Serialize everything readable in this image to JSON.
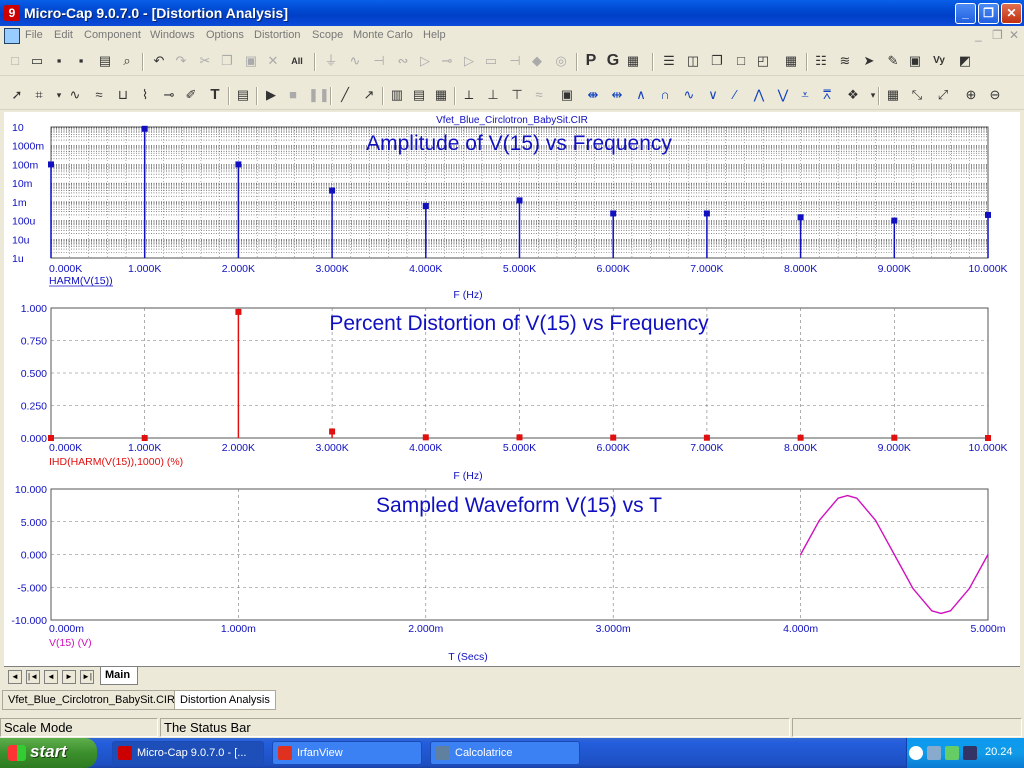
{
  "window": {
    "title": "Micro-Cap 9.0.7.0 - [Distortion Analysis]",
    "minimize": "_",
    "restore": "❐",
    "close": "✕"
  },
  "menu": {
    "items": [
      "File",
      "Edit",
      "Component",
      "Windows",
      "Options",
      "Distortion",
      "Scope",
      "Monte Carlo",
      "Help"
    ],
    "mdi_minimize": "_",
    "mdi_restore": "❐",
    "mdi_close": "✕"
  },
  "toolbar1": {
    "p_label": "P",
    "g_label": "G",
    "icons": [
      "new-icon",
      "open-icon",
      "save-icon",
      "save-all-icon",
      "print-icon",
      "print-preview-icon",
      "undo-icon",
      "redo-icon",
      "cut-icon",
      "copy-icon",
      "paste-icon",
      "delete-icon",
      "select-all-icon",
      "ground-icon",
      "resistor-icon",
      "capacitor-icon",
      "inductor-icon",
      "diode-icon",
      "transistor-icon",
      "opamp-icon",
      "macro-icon",
      "battery-icon",
      "node-icon",
      "source-icon",
      "probe-icon",
      "tile-horizontal-icon",
      "tile-vertical-icon",
      "cascade-icon",
      "maximize-icon",
      "restore-icon",
      "calculator-icon",
      "component-list-icon",
      "waveform-icon",
      "pen-icon",
      "eyedropper-icon",
      "picture-icon",
      "vy-icon",
      "window-icon"
    ]
  },
  "toolbar2": {
    "text_tool": "T",
    "icons": [
      "select-arrow-icon",
      "select-mode-icon",
      "wire-icon",
      "bezier-icon",
      "flag-icon",
      "grid-icon",
      "pin-icon",
      "text-tool-icon",
      "properties-icon",
      "run-icon",
      "stop-icon",
      "pause-icon",
      "line-icon",
      "arrow-line-icon",
      "grid-on-icon",
      "table-icon",
      "minor-grid-icon",
      "cursor-mode-icon",
      "peak-icon",
      "valley-icon",
      "slope-icon",
      "waveform-tool-icon",
      "scale-icon",
      "cursor-left-icon",
      "cursor-right-icon",
      "peak-cursor-icon",
      "valley-cursor-icon",
      "high-cursor-icon",
      "low-cursor-icon",
      "inflection-icon",
      "global-high-icon",
      "global-low-icon",
      "top-icon",
      "bottom-icon",
      "same-y-icon",
      "library-icon",
      "numeric-output-icon",
      "xy-scale-icon",
      "auto-scale-icon",
      "zoom-in-icon",
      "zoom-out-icon"
    ]
  },
  "circuit_name": "Vfet_Blue_Circlotron_BabySit.CIR",
  "plots": {
    "amplitude": {
      "title": "Amplitude of V(15) vs Frequency",
      "trace_label": "HARM(V(15))",
      "xlabel": "F (Hz)",
      "color": "#1010C0",
      "yticks": [
        "10",
        "1000m",
        "100m",
        "10m",
        "1m",
        "100u",
        "10u",
        "1u"
      ],
      "xticks": [
        "0.000K",
        "1.000K",
        "2.000K",
        "3.000K",
        "4.000K",
        "5.000K",
        "6.000K",
        "7.000K",
        "8.000K",
        "9.000K",
        "10.000K"
      ]
    },
    "distortion": {
      "title": "Percent Distortion of V(15) vs Frequency",
      "trace_label": "IHD(HARM(V(15)),1000) (%)",
      "xlabel": "F (Hz)",
      "color": "#E01010",
      "yticks": [
        "1.000",
        "0.750",
        "0.500",
        "0.250",
        "0.000"
      ],
      "xticks": [
        "0.000K",
        "1.000K",
        "2.000K",
        "3.000K",
        "4.000K",
        "5.000K",
        "6.000K",
        "7.000K",
        "8.000K",
        "9.000K",
        "10.000K"
      ]
    },
    "waveform": {
      "title": "Sampled Waveform  V(15) vs T",
      "trace_label": "V(15) (V)",
      "xlabel": "T (Secs)",
      "color": "#D010C0",
      "yticks": [
        "10.000",
        "5.000",
        "0.000",
        "-5.000",
        "-10.000"
      ],
      "xticks": [
        "0.000m",
        "1.000m",
        "2.000m",
        "3.000m",
        "4.000m",
        "5.000m"
      ]
    }
  },
  "chart_data": [
    {
      "type": "bar",
      "title": "Amplitude of V(15) vs Frequency",
      "xlabel": "F (Hz)",
      "ylabel": "HARM(V(15))",
      "yscale": "log",
      "ylim": [
        1e-06,
        10
      ],
      "xlim": [
        0,
        10000
      ],
      "x": [
        0,
        1000,
        2000,
        3000,
        4000,
        5000,
        6000,
        7000,
        8000,
        9000,
        10000
      ],
      "values": [
        0.1,
        8.0,
        0.1,
        0.004,
        0.0006,
        0.0012,
        0.00024,
        0.00024,
        0.00015,
        0.0001,
        0.0002
      ]
    },
    {
      "type": "bar",
      "title": "Percent Distortion of V(15) vs Frequency",
      "xlabel": "F (Hz)",
      "ylabel": "IHD(HARM(V(15)),1000) (%)",
      "ylim": [
        0,
        1
      ],
      "xlim": [
        0,
        10000
      ],
      "x": [
        0,
        1000,
        2000,
        3000,
        4000,
        5000,
        6000,
        7000,
        8000,
        9000,
        10000
      ],
      "values": [
        0.0,
        0.0,
        0.97,
        0.05,
        0.005,
        0.005,
        0.003,
        0.002,
        0.002,
        0.002,
        0.0
      ]
    },
    {
      "type": "line",
      "title": "Sampled Waveform  V(15) vs T",
      "xlabel": "T (Secs)",
      "ylabel": "V(15) (V)",
      "ylim": [
        -10,
        10
      ],
      "xlim": [
        0,
        0.005
      ],
      "x": [
        0.004,
        0.0041,
        0.0042,
        0.00425,
        0.0043,
        0.0044,
        0.0045,
        0.0046,
        0.0047,
        0.00475,
        0.0048,
        0.0049,
        0.005
      ],
      "values": [
        0.0,
        5.2,
        8.6,
        9.0,
        8.6,
        5.2,
        0.0,
        -5.2,
        -8.6,
        -9.0,
        -8.6,
        -5.2,
        0.0
      ]
    }
  ],
  "tabs": {
    "main": "Main",
    "nav": [
      "◄",
      "|◄",
      "◄",
      "►",
      "►|"
    ]
  },
  "doc_tabs": [
    "Vfet_Blue_Circlotron_BabySit.CIR",
    "Distortion Analysis"
  ],
  "status": {
    "mode": "Scale Mode",
    "message": "The Status Bar"
  },
  "taskbar": {
    "start": "start",
    "tasks": [
      "Micro-Cap 9.0.7.0 - [...",
      "IrfanView",
      "Calcolatrice"
    ],
    "clock": "20.24",
    "task_colors": [
      "#CC0000",
      "#E03020",
      "#6080A0"
    ]
  }
}
